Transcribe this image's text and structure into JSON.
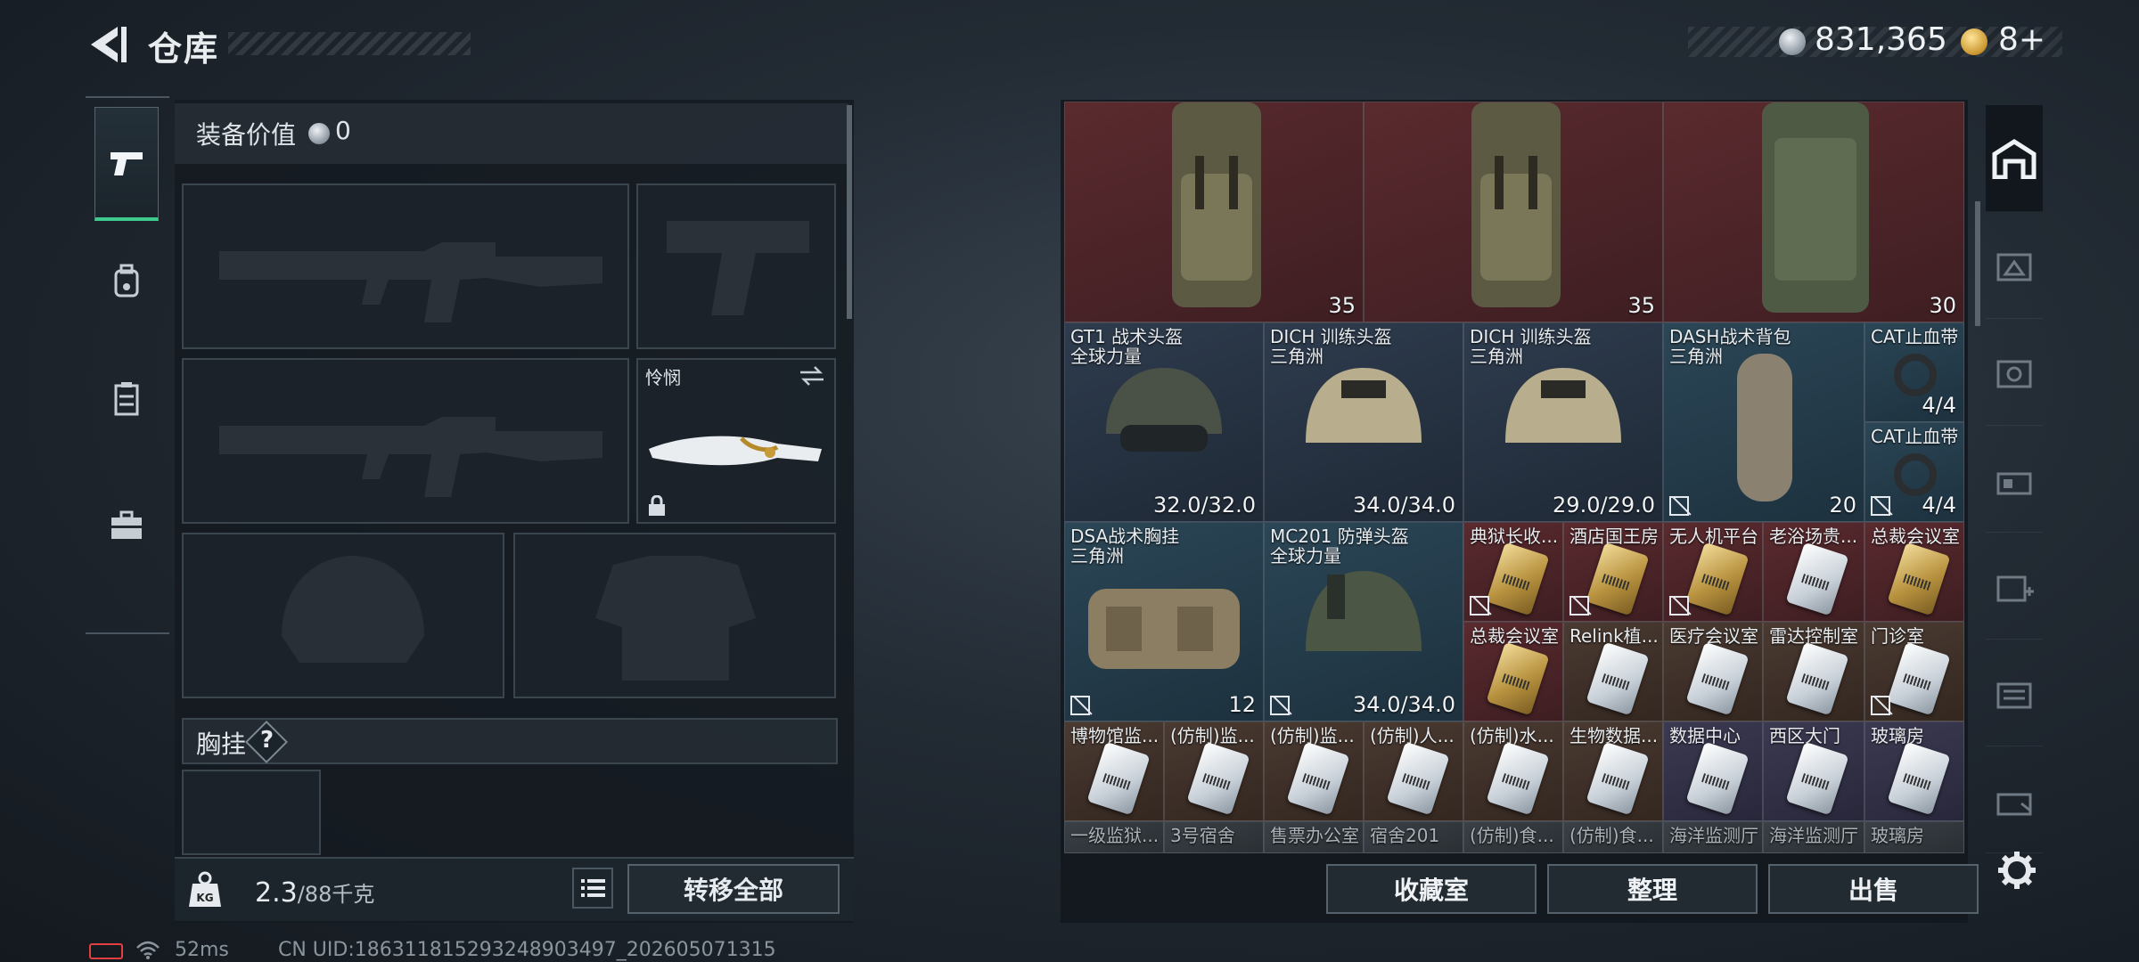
{
  "header": {
    "title": "仓库",
    "money": "831,365",
    "tickets": "8+"
  },
  "equipment": {
    "value_label": "装备价值",
    "value": "0",
    "melee_name": "怜悯",
    "chest_label": "胸挂",
    "chest_help": "?",
    "weight": "2.3",
    "weight_max": "/88千克",
    "transfer_label": "转移全部"
  },
  "storage": {
    "top_counts": [
      "35",
      "35",
      "30"
    ],
    "row2": [
      {
        "name": "GT1 战术头盔",
        "origin": "全球力量",
        "value": "32.0/32.0"
      },
      {
        "name": "DICH 训练头盔",
        "origin": "三角洲",
        "value": "34.0/34.0"
      },
      {
        "name": "DICH 训练头盔",
        "origin": "三角洲",
        "value": "29.0/29.0"
      },
      {
        "name": "DASH战术背包",
        "origin": "三角洲",
        "value": "20"
      },
      {
        "name": "CAT止血带",
        "value": "4/4"
      },
      {
        "name": "CAT止血带",
        "value": "4/4"
      }
    ],
    "row3": [
      {
        "name": "DSA战术胸挂",
        "origin": "三角洲",
        "value": "12"
      },
      {
        "name": "MC201 防弹头盔",
        "origin": "全球力量",
        "value": "34.0/34.0"
      }
    ],
    "keys_a": [
      "典狱长收...",
      "酒店国王房",
      "无人机平台",
      "老浴场贵...",
      "总裁会议室"
    ],
    "keys_b": [
      "总裁会议室",
      "Relink植...",
      "医疗会议室",
      "雷达控制室",
      "门诊室"
    ],
    "keys_c": [
      "博物馆监...",
      "(仿制)监...",
      "(仿制)监...",
      "(仿制)人...",
      "(仿制)水...",
      "生物数据...",
      "数据中心",
      "西区大门",
      "玻璃房"
    ],
    "keys_d": [
      "一级监狱...",
      "3号宿舍",
      "售票办公室",
      "宿舍201",
      "(仿制)食...",
      "(仿制)食...",
      "海洋监测厅",
      "海洋监测厅",
      "玻璃房"
    ]
  },
  "actions": {
    "collection": "收藏室",
    "sort": "整理",
    "sell": "出售"
  },
  "footer": {
    "ping": "52ms",
    "uid": "CN UID:18631181529324890349​7_202605071315"
  }
}
